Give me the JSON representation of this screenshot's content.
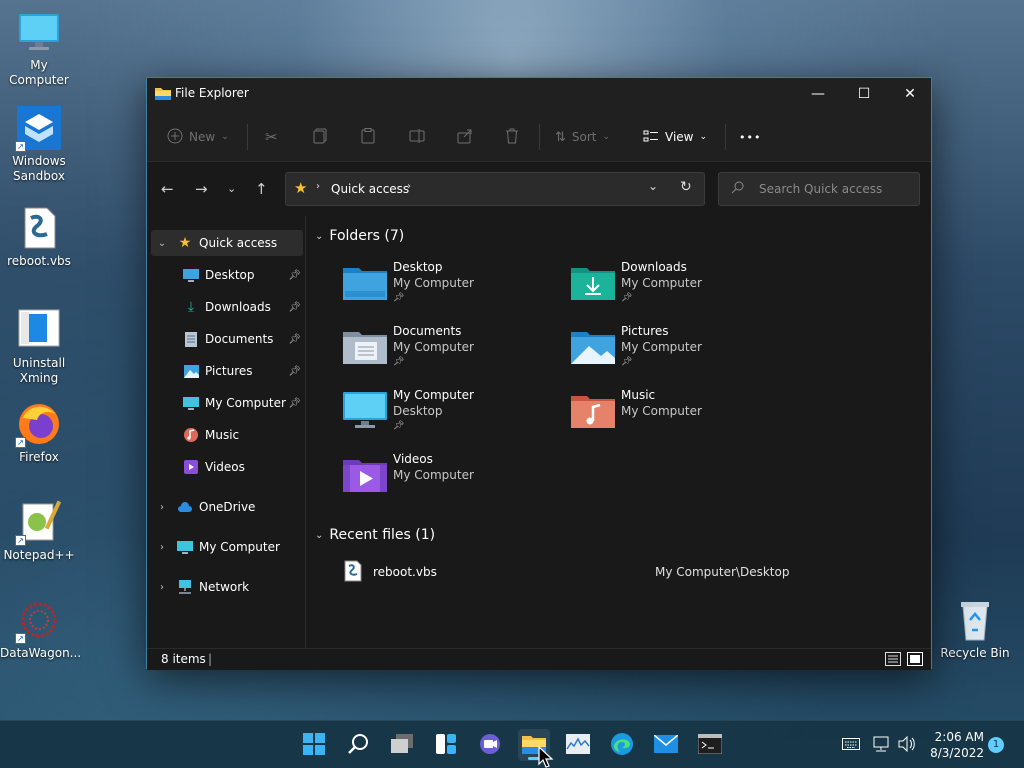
{
  "desktop": {
    "icons": [
      {
        "label": "My Computer"
      },
      {
        "label": "Windows Sandbox"
      },
      {
        "label": "reboot.vbs"
      },
      {
        "label": "Uninstall Xming"
      },
      {
        "label": "Firefox"
      },
      {
        "label": "Notepad++"
      },
      {
        "label": "DataWagon..."
      },
      {
        "label": "Recycle Bin"
      }
    ]
  },
  "window": {
    "title": "File Explorer",
    "controls": {
      "minimize": "—",
      "maximize": "☐",
      "close": "✕"
    }
  },
  "toolbar": {
    "new_label": "New",
    "sort_label": "Sort",
    "view_label": "View",
    "more_label": "•••"
  },
  "address": {
    "location": "Quick access",
    "search_placeholder": "Search Quick access"
  },
  "sidebar": {
    "quick_access": "Quick access",
    "pinned": [
      {
        "label": "Desktop",
        "icon": "desktop-icon"
      },
      {
        "label": "Downloads",
        "icon": "downloads-icon"
      },
      {
        "label": "Documents",
        "icon": "documents-icon"
      },
      {
        "label": "Pictures",
        "icon": "pictures-icon"
      },
      {
        "label": "My Computer",
        "icon": "computer-icon"
      },
      {
        "label": "Music",
        "icon": "music-icon"
      },
      {
        "label": "Videos",
        "icon": "videos-icon"
      }
    ],
    "roots": [
      {
        "label": "OneDrive",
        "icon": "cloud-icon"
      },
      {
        "label": "My Computer",
        "icon": "computer-icon"
      },
      {
        "label": "Network",
        "icon": "network-icon"
      }
    ]
  },
  "content": {
    "folders_header": "Folders (7)",
    "folders": [
      {
        "name": "Desktop",
        "location": "My Computer",
        "pinned": true
      },
      {
        "name": "Downloads",
        "location": "My Computer",
        "pinned": true
      },
      {
        "name": "Documents",
        "location": "My Computer",
        "pinned": true
      },
      {
        "name": "Pictures",
        "location": "My Computer",
        "pinned": true
      },
      {
        "name": "My Computer",
        "location": "Desktop",
        "pinned": true
      },
      {
        "name": "Music",
        "location": "My Computer",
        "pinned": false
      },
      {
        "name": "Videos",
        "location": "My Computer",
        "pinned": false
      }
    ],
    "recent_header": "Recent files (1)",
    "recent": [
      {
        "name": "reboot.vbs",
        "path": "My Computer\\Desktop"
      }
    ]
  },
  "status": {
    "items": "8 items"
  },
  "taskbar": {
    "time": "2:06 AM",
    "date": "8/3/2022",
    "notifications": "1"
  },
  "colors": {
    "accent": "#60cdff",
    "window_bg": "#191919",
    "chrome_bg": "#202020",
    "folder_blue": "#3fa3e0",
    "folder_teal": "#1cb39b"
  }
}
